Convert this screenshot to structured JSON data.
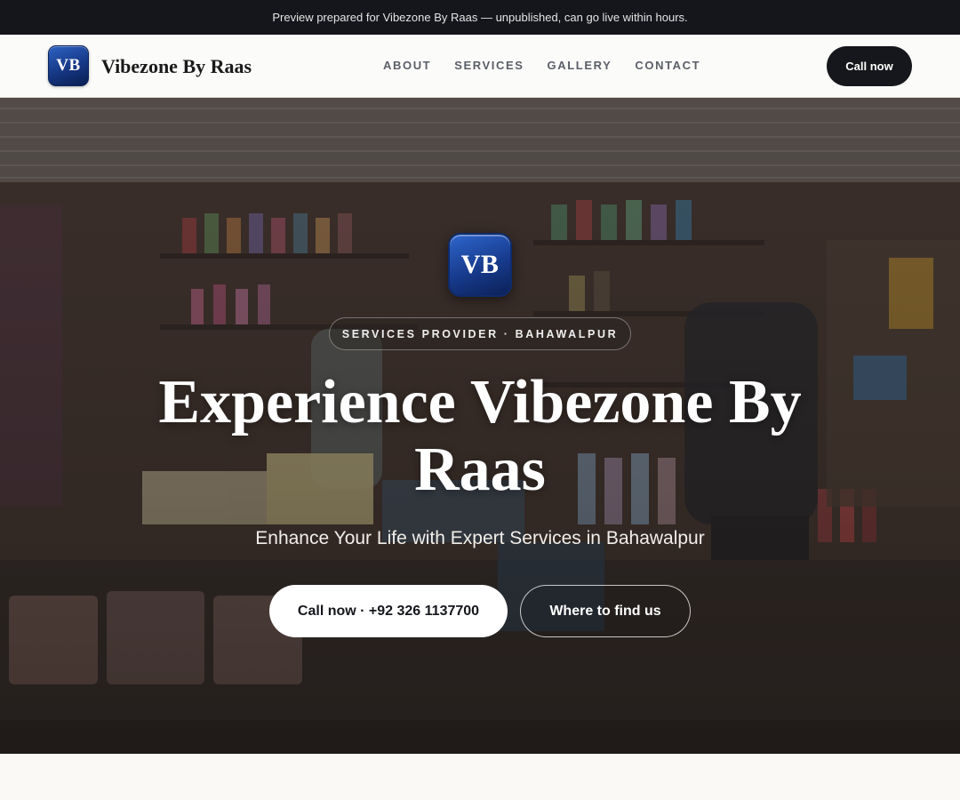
{
  "banner": {
    "text": "Preview prepared for Vibezone By Raas — unpublished, can go live within hours."
  },
  "header": {
    "logo_text": "VB",
    "brand_name": "Vibezone By Raas",
    "nav": [
      {
        "label": "ABOUT"
      },
      {
        "label": "SERVICES"
      },
      {
        "label": "GALLERY"
      },
      {
        "label": "CONTACT"
      }
    ],
    "cta_label": "Call now"
  },
  "hero": {
    "logo_text": "VB",
    "eyebrow": "SERVICES PROVIDER · BAHAWALPUR",
    "title": "Experience Vibezone By Raas",
    "subtitle": "Enhance Your Life with Expert Services in Bahawalpur",
    "primary_cta": "Call now · +92 326 1137700",
    "secondary_cta": "Where to find us",
    "background_image": "shop-storefront-photo"
  },
  "colors": {
    "banner_bg": "#14161b",
    "dark_button": "#15171c",
    "logo_blue": "#173a8c",
    "page_bg": "#faf9f6"
  }
}
